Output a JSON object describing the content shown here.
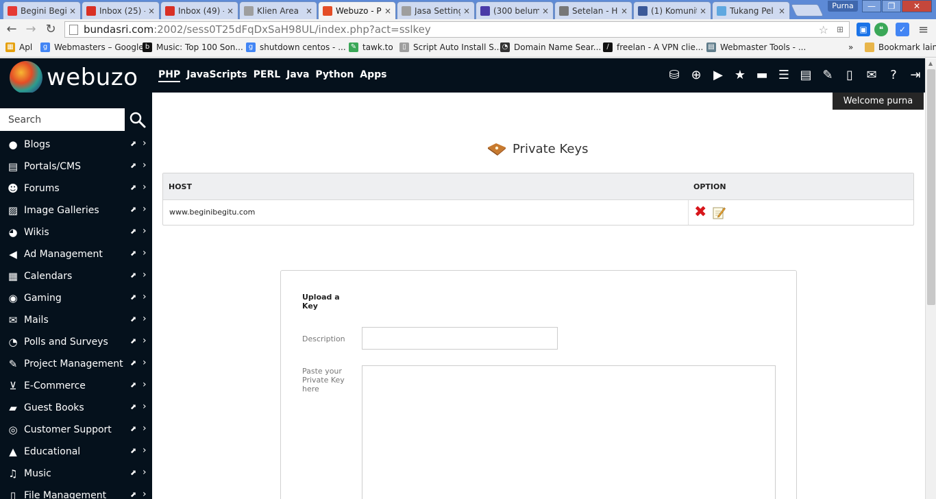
{
  "browser": {
    "tabs": [
      {
        "title": "Begini Begitu",
        "color": "#e53935"
      },
      {
        "title": "Inbox (25) -",
        "color": "#d93025"
      },
      {
        "title": "Inbox (49) -",
        "color": "#d93025"
      },
      {
        "title": "Klien Area",
        "color": "#9e9e9e"
      },
      {
        "title": "Webuzo - P",
        "color": "#e44d26"
      },
      {
        "title": "Jasa Setting",
        "color": "#9e9e9e"
      },
      {
        "title": "(300 belum",
        "color": "#4a3aa8"
      },
      {
        "title": "Setelan - H",
        "color": "#777777"
      },
      {
        "title": "(1) Komunit",
        "color": "#3b5998"
      },
      {
        "title": "Tukang Pel",
        "color": "#5fa8e0"
      }
    ],
    "profile": "Purna",
    "window_buttons": {
      "minimize": "—",
      "maximize": "❐",
      "close": "✕"
    },
    "url_host": "bundasri.com",
    "url_rest": ":2002/sess0T25dFqDxSaH98UL/index.php?act=sslkey",
    "bookmarks": [
      {
        "label": "Apl",
        "color": "#e5a00d",
        "glyph": "▦"
      },
      {
        "label": "Webmasters – Google",
        "color": "#4285f4",
        "glyph": "g"
      },
      {
        "label": "Music: Top 100 Son...",
        "color": "#111111",
        "glyph": "b"
      },
      {
        "label": "shutdown centos - ...",
        "color": "#4285f4",
        "glyph": "g"
      },
      {
        "label": "tawk.to",
        "color": "#3aa757",
        "glyph": "✎"
      },
      {
        "label": "Script Auto Install S...",
        "color": "#9e9e9e",
        "glyph": "▯"
      },
      {
        "label": "Domain Name Sear...",
        "color": "#333333",
        "glyph": "◔"
      },
      {
        "label": "freelan - A VPN clie...",
        "color": "#111111",
        "glyph": "∕"
      },
      {
        "label": "Webmaster Tools - ...",
        "color": "#607d8b",
        "glyph": "▤"
      }
    ],
    "bookmarks_more": "»",
    "bookmark_other": "Bookmark lain"
  },
  "header": {
    "logo_text": "webuzo",
    "nav": [
      "PHP",
      "JavaScripts",
      "PERL",
      "Java",
      "Python",
      "Apps"
    ],
    "active_nav": "PHP",
    "icons": [
      {
        "name": "server-icon",
        "glyph": "⛁"
      },
      {
        "name": "globe-icon",
        "glyph": "⊕"
      },
      {
        "name": "play-icon",
        "glyph": "▶"
      },
      {
        "name": "star-icon",
        "glyph": "★"
      },
      {
        "name": "archive-icon",
        "glyph": "▬"
      },
      {
        "name": "database-icon",
        "glyph": "☰"
      },
      {
        "name": "list-icon",
        "glyph": "▤"
      },
      {
        "name": "wrench-icon",
        "glyph": "✎"
      },
      {
        "name": "file-icon",
        "glyph": "▯"
      },
      {
        "name": "mail-icon",
        "glyph": "✉"
      },
      {
        "name": "help-icon",
        "glyph": "?"
      },
      {
        "name": "logout-icon",
        "glyph": "⇥"
      }
    ],
    "welcome": "Welcome purna"
  },
  "sidebar": {
    "search_placeholder": "Search",
    "items": [
      {
        "label": "Blogs",
        "icon": "user-icon",
        "glyph": "●"
      },
      {
        "label": "Portals/CMS",
        "icon": "portal-icon",
        "glyph": "▤"
      },
      {
        "label": "Forums",
        "icon": "users-icon",
        "glyph": "☻"
      },
      {
        "label": "Image Galleries",
        "icon": "image-icon",
        "glyph": "▨"
      },
      {
        "label": "Wikis",
        "icon": "globe-icon",
        "glyph": "◕"
      },
      {
        "label": "Ad Management",
        "icon": "megaphone-icon",
        "glyph": "◀"
      },
      {
        "label": "Calendars",
        "icon": "calendar-icon",
        "glyph": "▦"
      },
      {
        "label": "Gaming",
        "icon": "gamepad-icon",
        "glyph": "◉"
      },
      {
        "label": "Mails",
        "icon": "mail-icon",
        "glyph": "✉"
      },
      {
        "label": "Polls and Surveys",
        "icon": "pie-chart-icon",
        "glyph": "◔"
      },
      {
        "label": "Project Management",
        "icon": "edit-icon",
        "glyph": "✎"
      },
      {
        "label": "E-Commerce",
        "icon": "cart-icon",
        "glyph": "⊻"
      },
      {
        "label": "Guest Books",
        "icon": "book-icon",
        "glyph": "▰"
      },
      {
        "label": "Customer Support",
        "icon": "lifebuoy-icon",
        "glyph": "◎"
      },
      {
        "label": "Educational",
        "icon": "graduation-cap-icon",
        "glyph": "▲"
      },
      {
        "label": "Music",
        "icon": "music-icon",
        "glyph": "♫"
      },
      {
        "label": "File Management",
        "icon": "folder-icon",
        "glyph": "▯"
      }
    ]
  },
  "main": {
    "title": "Private Keys",
    "table": {
      "headers": [
        "HOST",
        "OPTION"
      ],
      "rows": [
        {
          "host": "www.beginibegitu.com"
        }
      ]
    },
    "upload": {
      "heading": "Upload a Key",
      "description_label": "Description",
      "description_value": "",
      "key_label": "Paste your Private Key here",
      "key_value": ""
    }
  }
}
